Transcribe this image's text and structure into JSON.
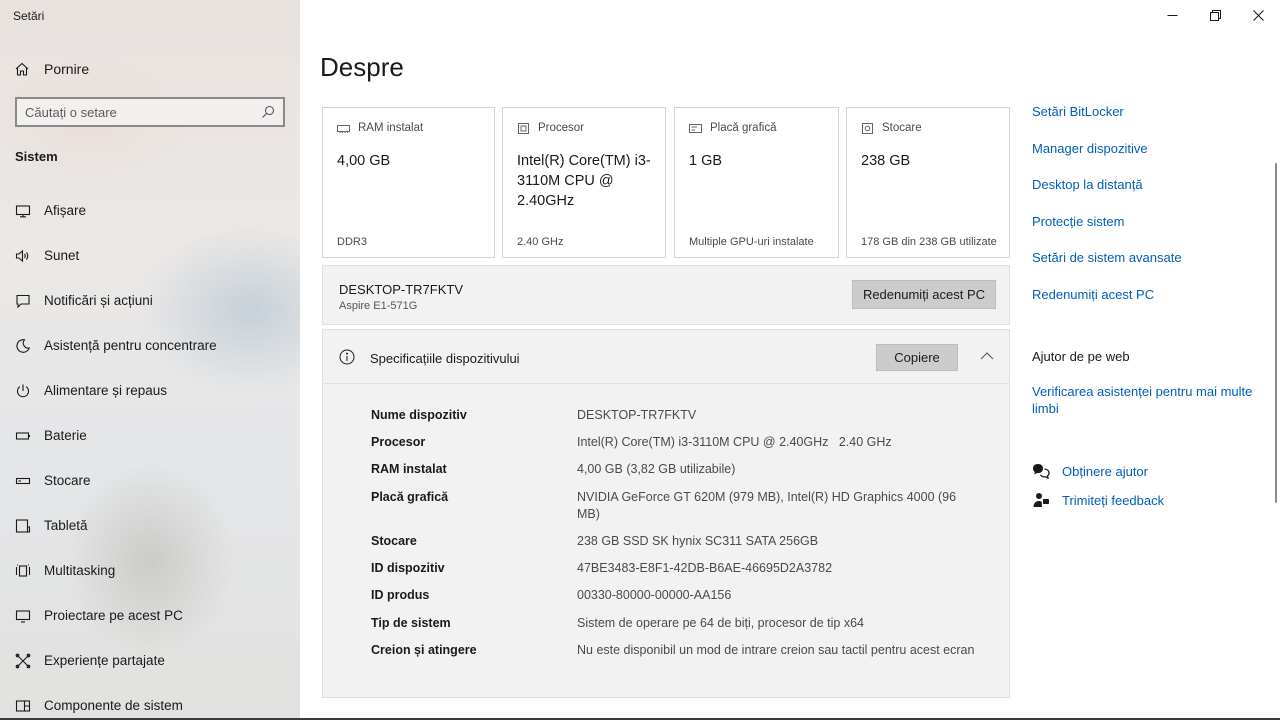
{
  "window": {
    "title": "Setări"
  },
  "sidebar": {
    "home_label": "Pornire",
    "search_placeholder": "Căutați o setare",
    "section_title": "Sistem",
    "items": [
      {
        "label": "Afișare",
        "icon": "display-icon"
      },
      {
        "label": "Sunet",
        "icon": "speaker-icon"
      },
      {
        "label": "Notificări și acțiuni",
        "icon": "notifications-icon"
      },
      {
        "label": "Asistență pentru concentrare",
        "icon": "moon-icon"
      },
      {
        "label": "Alimentare și repaus",
        "icon": "power-icon"
      },
      {
        "label": "Baterie",
        "icon": "battery-icon"
      },
      {
        "label": "Stocare",
        "icon": "storage-icon"
      },
      {
        "label": "Tabletă",
        "icon": "tablet-icon"
      },
      {
        "label": "Multitasking",
        "icon": "multitasking-icon"
      },
      {
        "label": "Proiectare pe acest PC",
        "icon": "projecting-icon"
      },
      {
        "label": "Experiențe partajate",
        "icon": "shared-experiences-icon"
      },
      {
        "label": "Componente de sistem",
        "icon": "system-components-icon"
      }
    ]
  },
  "main": {
    "title": "Despre",
    "cards": [
      {
        "label": "RAM instalat",
        "value": "4,00 GB",
        "sub": "DDR3",
        "icon": "ram-icon"
      },
      {
        "label": "Procesor",
        "value": "Intel(R) Core(TM) i3-3110M CPU @ 2.40GHz",
        "sub": "2.40 GHz",
        "icon": "processor-icon"
      },
      {
        "label": "Placă grafică",
        "value": "1 GB",
        "sub": "Multiple GPU-uri instalate",
        "icon": "graphics-card-icon"
      },
      {
        "label": "Stocare",
        "value": "238 GB",
        "sub": "178 GB din 238 GB utilizate",
        "icon": "storage-icon"
      }
    ],
    "device": {
      "name": "DESKTOP-TR7FKTV",
      "model": "Aspire E1-571G",
      "rename_button": "Redenumiți acest PC"
    },
    "specs": {
      "title": "Specificațiile dispozitivului",
      "copy_button": "Copiere",
      "rows": [
        {
          "key": "Nume dispozitiv",
          "value": "DESKTOP-TR7FKTV"
        },
        {
          "key": "Procesor",
          "value": "Intel(R) Core(TM) i3-3110M CPU @ 2.40GHz   2.40 GHz"
        },
        {
          "key": "RAM instalat",
          "value": "4,00 GB (3,82 GB utilizabile)"
        },
        {
          "key": "Placă grafică",
          "value": "NVIDIA GeForce GT 620M (979 MB), Intel(R) HD Graphics 4000 (96 MB)"
        },
        {
          "key": "Stocare",
          "value": "238 GB SSD SK hynix SC311 SATA 256GB"
        },
        {
          "key": "ID dispozitiv",
          "value": "47BE3483-E8F1-42DB-B6AE-46695D2A3782"
        },
        {
          "key": "ID produs",
          "value": "00330-80000-00000-AA156"
        },
        {
          "key": "Tip de sistem",
          "value": "Sistem de operare pe 64 de biți, procesor de tip x64"
        },
        {
          "key": "Creion și atingere",
          "value": "Nu este disponibil un mod de intrare creion sau tactil pentru acest ecran"
        }
      ]
    }
  },
  "related": {
    "links": [
      "Setări BitLocker",
      "Manager dispozitive",
      "Desktop la distanță",
      "Protecție sistem",
      "Setări de sistem avansate",
      "Redenumiți acest PC"
    ],
    "web_title": "Ajutor de pe web",
    "web_link": "Verificarea asistenței pentru mai multe limbi",
    "help_link": "Obținere ajutor",
    "feedback_link": "Trimiteți feedback"
  },
  "colors": {
    "link": "#005fb8",
    "button": "#cccccc",
    "panel": "#f2f2f2"
  }
}
